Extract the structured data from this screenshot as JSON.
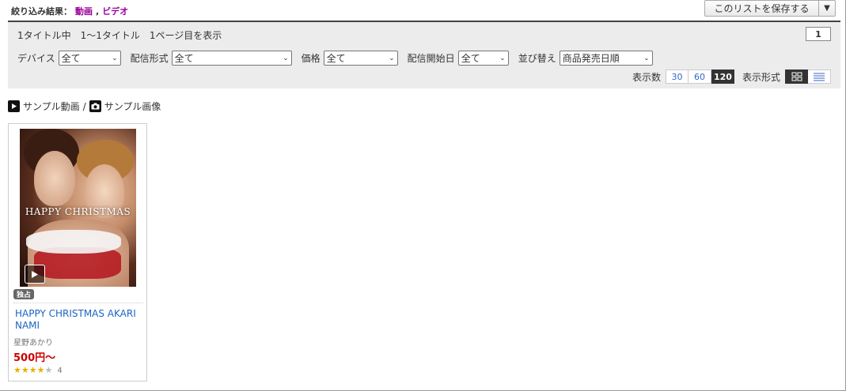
{
  "filter": {
    "label": "絞り込み結果：",
    "link1": "動画",
    "sep": ",",
    "link2": "ビデオ"
  },
  "save": {
    "label": "このリストを保存する",
    "arrow": "▼"
  },
  "summary": {
    "text": "1タイトル中　1～1タイトル　1ページ目を表示",
    "page": "1"
  },
  "filters": [
    {
      "label": "デバイス",
      "value": "全て"
    },
    {
      "label": "配信形式",
      "value": "全て"
    },
    {
      "label": "価格",
      "value": "全て"
    },
    {
      "label": "配信開始日",
      "value": "全て"
    },
    {
      "label": "並び替え",
      "value": "商品発売日順"
    }
  ],
  "display": {
    "count_label": "表示数",
    "counts": [
      "30",
      "60",
      "120"
    ],
    "active_count": "120",
    "format_label": "表示形式",
    "formats": [
      "grid-icon",
      "list-icon"
    ],
    "active_format": "grid-icon"
  },
  "legend": {
    "video": "サンプル動画",
    "sep": "/",
    "image": "サンプル画像"
  },
  "product": {
    "thumb_title": "HAPPY CHRISTMAS",
    "badge": "独占",
    "title": "HAPPY CHRISTMAS AKARI NAMI",
    "actress": "星野あかり",
    "price": "500円～",
    "rating_stars": 4,
    "rating_max": 5,
    "rating_count": "4"
  },
  "colors": {
    "link": "#990099",
    "title": "#1a64c4",
    "price": "#cc0000",
    "star": "#e8b100",
    "panel": "#ececec"
  }
}
